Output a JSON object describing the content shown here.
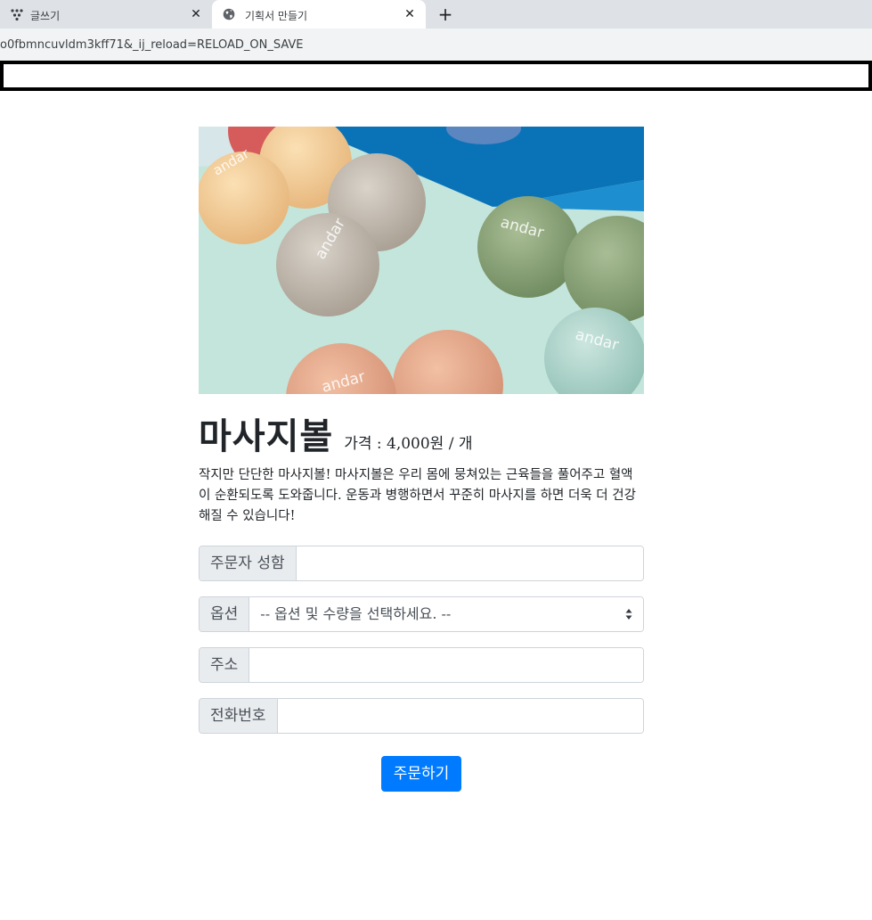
{
  "browser": {
    "tabs": [
      {
        "title": "글쓰기",
        "active": false
      },
      {
        "title": "기획서 만들기",
        "active": true
      }
    ],
    "close_glyph": "✕",
    "new_tab_glyph": "+",
    "url": "o0fbmncuvldm3kff71&_ij_reload=RELOAD_ON_SAVE"
  },
  "product": {
    "brand_text": "andar",
    "name": "마사지볼",
    "price": "가격 : 4,000원 / 개",
    "description": "작지만 단단한 마사지볼! 마사지볼은 우리 몸에 뭉쳐있는 근육들을 풀어주고 혈액이 순환되도록 도와줍니다. 운동과 병행하면서 꾸준히 마사지를 하면 더욱 더 건강해질 수 있습니다!"
  },
  "form": {
    "name_label": "주문자 성함",
    "name_value": "",
    "option_label": "옵션",
    "option_selected": "-- 옵션 및 수량을 선택하세요. --",
    "address_label": "주소",
    "address_value": "",
    "phone_label": "전화번호",
    "phone_value": "",
    "submit_label": "주문하기"
  },
  "colors": {
    "primary": "#007bff",
    "addon_bg": "#e9ecef",
    "border": "#ced4da"
  }
}
